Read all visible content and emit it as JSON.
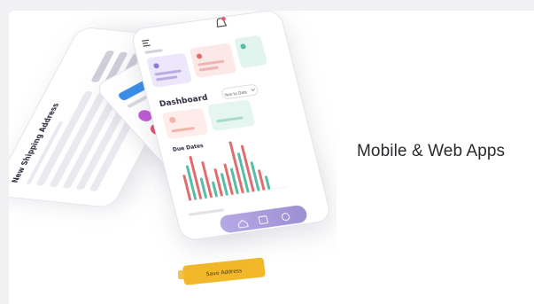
{
  "headline": "Mobile & Web Apps",
  "colors": {
    "page_bg": "#f1f1f3",
    "card_bg": "#ffffff",
    "accent_purple": "#a79bd8",
    "accent_blue": "#3a8ee8",
    "accent_yellow": "#f2b829",
    "bar_red": "#e36b6b",
    "bar_teal": "#57bca4"
  },
  "front_phone": {
    "section_title": "Dashboard",
    "filter_label": "Year to Date",
    "chart_title": "Due Dates"
  },
  "back_phone": {
    "section_title": "New Shipping Address",
    "confirm_label": "Save Address"
  },
  "icons": [
    "notification-bell-icon",
    "hamburger-menu-icon",
    "dropdown-chevron-icon",
    "home-icon",
    "calendar-icon",
    "settings-icon"
  ]
}
